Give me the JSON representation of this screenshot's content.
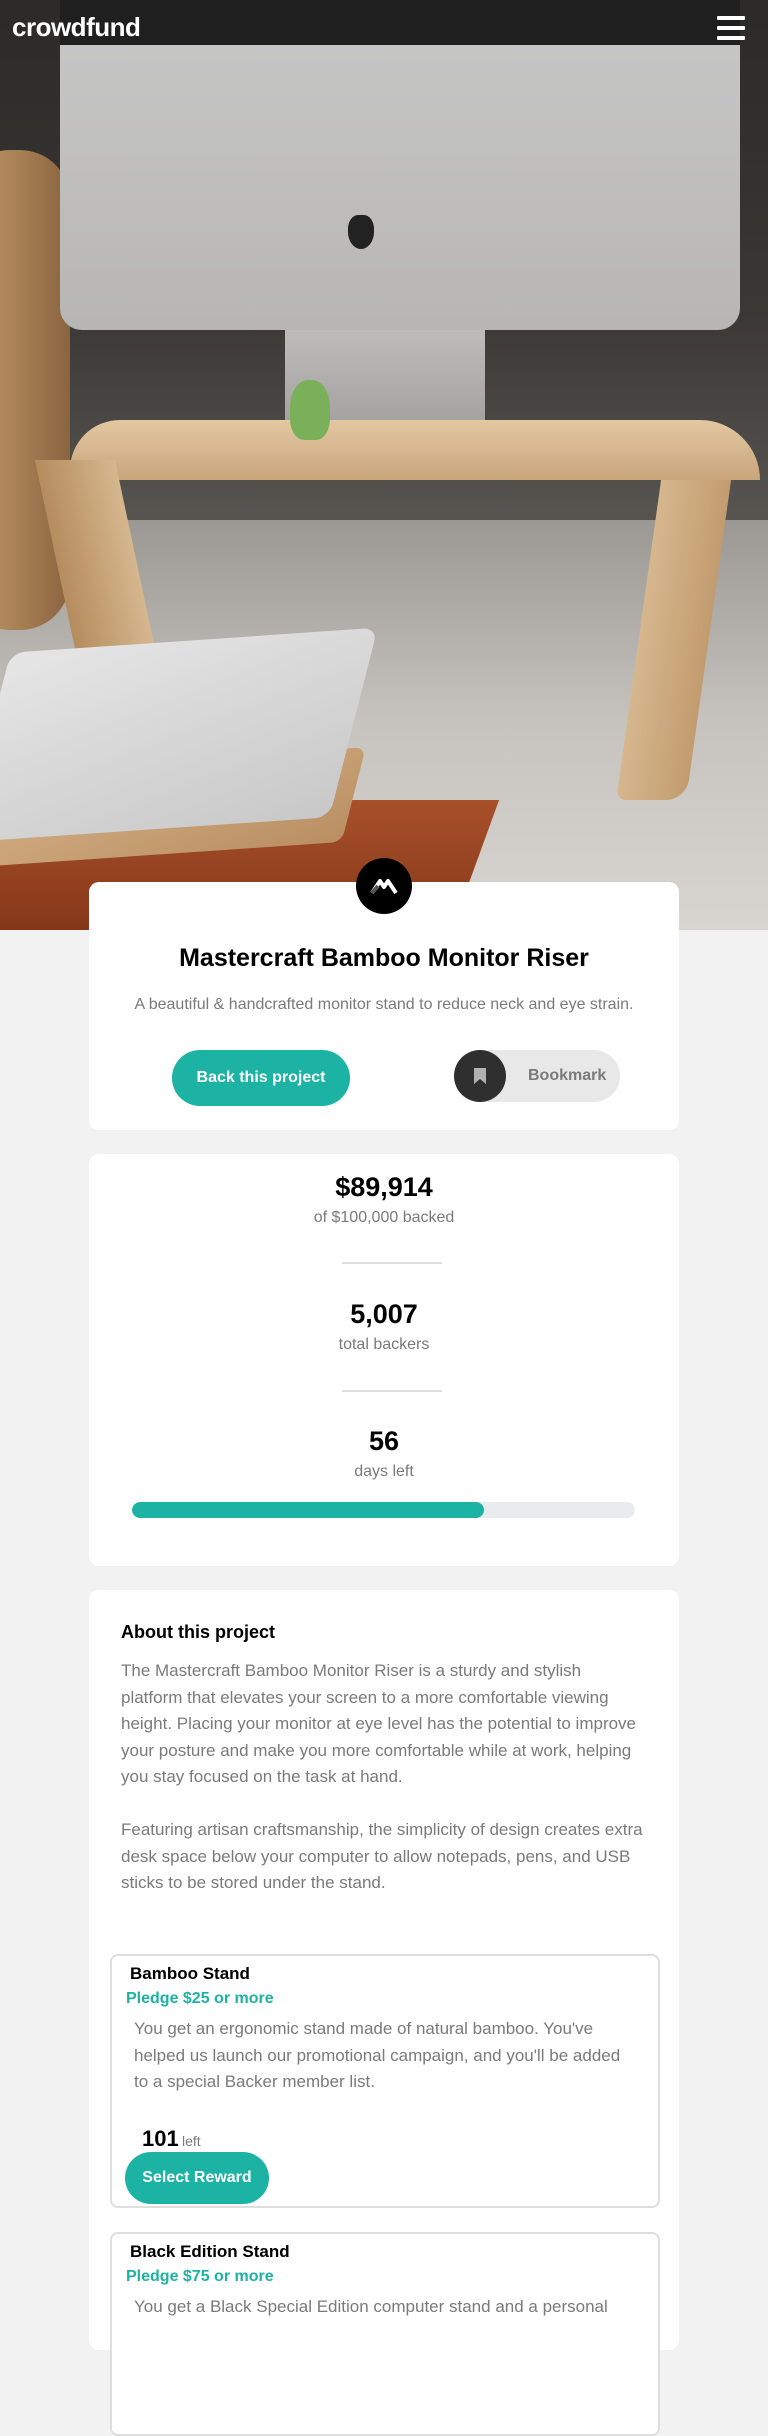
{
  "header": {
    "logo": "crowdfund",
    "menu_icon": "hamburger-icon"
  },
  "hero": {
    "image_alt": "Mastercraft Bamboo Monitor Riser"
  },
  "project": {
    "logo_icon": "mastercraft-logo-icon",
    "title": "Mastercraft Bamboo Monitor Riser",
    "subtitle": "A beautiful & handcrafted monitor stand to reduce neck and eye strain.",
    "back_label": "Back this project",
    "bookmark_label": "Bookmark",
    "bookmark_icon": "bookmark-icon"
  },
  "stats": {
    "backed_amount": "$89,914",
    "backed_label": "of $100,000 backed",
    "backers": "5,007",
    "backers_label": "total backers",
    "days": "56",
    "days_label": "days left",
    "progress_fraction": 0.7,
    "accent_color": "#1cb3a4"
  },
  "about": {
    "title": "About this project",
    "paragraph1": "The Mastercraft Bamboo Monitor Riser is a sturdy and stylish platform that elevates your screen to a more comfortable viewing height. Placing your monitor at eye level has the potential to improve your posture and make you more comfortable while at work, helping you stay focused on the task at hand.",
    "paragraph2": "Featuring artisan craftsmanship, the simplicity of design creates extra desk space below your computer to allow notepads, pens, and USB sticks to be stored under the stand."
  },
  "rewards": [
    {
      "name": "Bamboo Stand",
      "pledge": "Pledge $25 or more",
      "description": "You get an ergonomic stand made of natural bamboo. You've helped us launch our promotional campaign, and you'll be added to a special Backer member list.",
      "count": "101",
      "left_label": "left",
      "button": "Select Reward"
    },
    {
      "name": "Black Edition Stand",
      "pledge": "Pledge $75 or more",
      "description": "You get a Black Special Edition computer stand and a personal"
    }
  ]
}
